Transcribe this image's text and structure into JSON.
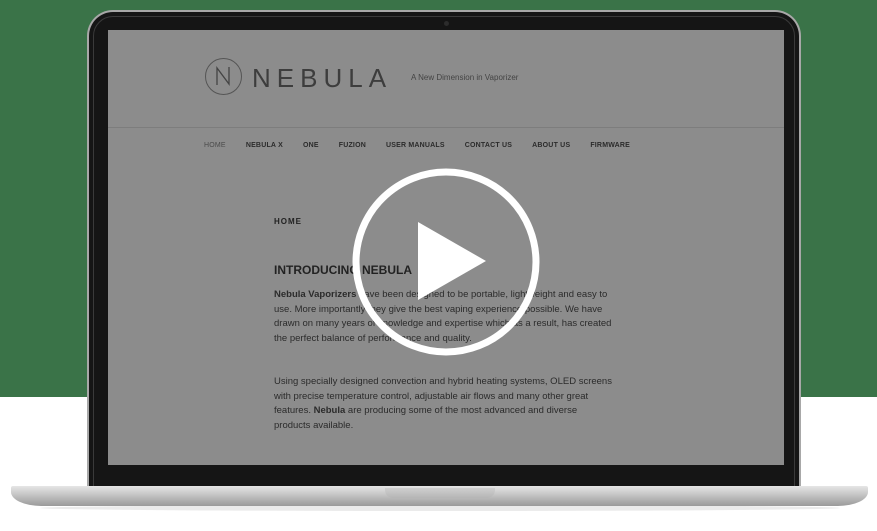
{
  "site": {
    "brand": "NEBULA",
    "tagline": "A New Dimension in Vaporizer"
  },
  "nav": {
    "items": [
      {
        "label": "HOME"
      },
      {
        "label": "NEBULA X"
      },
      {
        "label": "ONE"
      },
      {
        "label": "FUZION"
      },
      {
        "label": "USER MANUALS"
      },
      {
        "label": "CONTACT US"
      },
      {
        "label": "ABOUT US"
      },
      {
        "label": "FIRMWARE"
      }
    ]
  },
  "content": {
    "page_label": "HOME",
    "heading": "INTRODUCING NEBULA",
    "para1_bold": "Nebula Vaporizers",
    "para1_rest": " have been designed to be portable, lightweight and easy to use. More importantly they give the best vaping experience possible. We have drawn on many years of knowledge and expertise which as a result, has created the perfect balance of performance and quality.",
    "para2_start": "Using specially designed convection and hybrid heating systems, OLED screens with precise temperature control, adjustable air flows and many other great features. ",
    "para2_bold": "Nebula",
    "para2_end": " are producing some of the most advanced and diverse products available."
  },
  "overlay": {
    "icon": "play-icon"
  },
  "colors": {
    "background_green": "#3a7348",
    "screen_overlay": "#8c8c8c",
    "play_icon": "#ffffff"
  }
}
